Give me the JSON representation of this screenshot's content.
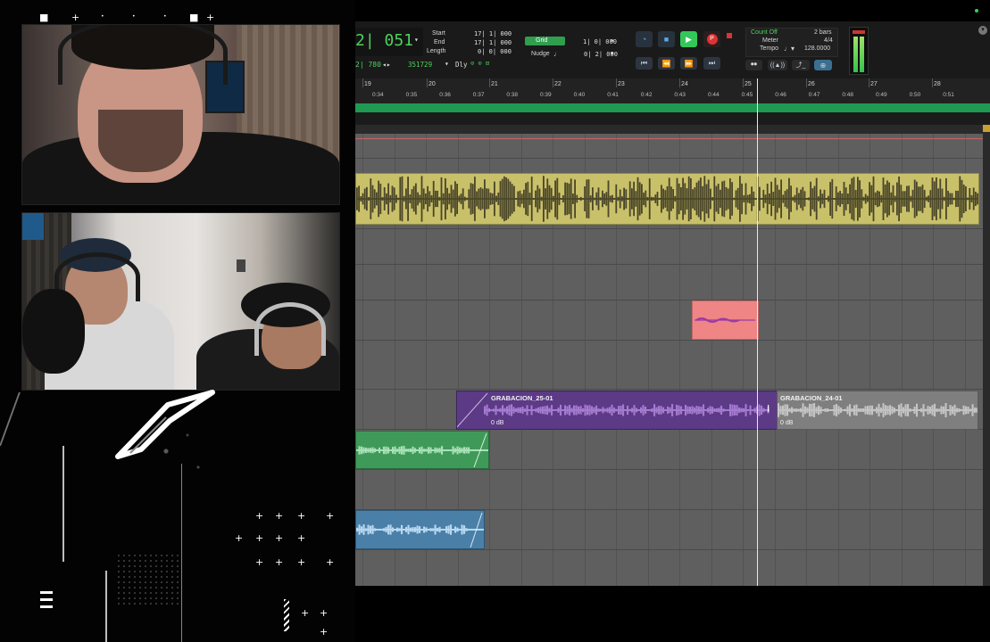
{
  "stream": {
    "logo": "white-v-logo-icon",
    "menu_icon": "menu-icon"
  },
  "transport": {
    "main_counter": "2| 051",
    "sub_counter": "2| 780",
    "samples": "351729",
    "dly": "Dly",
    "start_label": "Start",
    "end_label": "End",
    "length_label": "Length",
    "start_value": "17| 1| 000",
    "end_value": "17| 1| 000",
    "length_value": "0| 0| 000",
    "grid_label": "Grid",
    "grid_value": "1| 0| 000",
    "nudge_label": "Nudge",
    "nudge_value": "0| 2| 000",
    "count_off": "Count Off",
    "count_off_value": "2 bars",
    "meter_label": "Meter",
    "meter_value": "4/4",
    "tempo_label": "Tempo",
    "tempo_value": "128.0000"
  },
  "ruler": {
    "bars": [
      {
        "label": "19",
        "pos": 10
      },
      {
        "label": "20",
        "pos": 82
      },
      {
        "label": "21",
        "pos": 152
      },
      {
        "label": "22",
        "pos": 223
      },
      {
        "label": "23",
        "pos": 294
      },
      {
        "label": "24",
        "pos": 365
      },
      {
        "label": "25",
        "pos": 436
      },
      {
        "label": "26",
        "pos": 507
      },
      {
        "label": "27",
        "pos": 577
      },
      {
        "label": "28",
        "pos": 648
      }
    ],
    "times": [
      "0:34",
      "0:35",
      "0:36",
      "0:37",
      "0:38",
      "0:39",
      "0:40",
      "0:41",
      "0:42",
      "0:43",
      "0:44",
      "0:45",
      "0:46",
      "0:47",
      "0:48",
      "0:49",
      "0:50",
      "0:51"
    ]
  },
  "clips": {
    "grabacion_25": {
      "name": "GRABACION_25-01",
      "gain": "0 dB"
    },
    "grabacion_24": {
      "name": "GRABACION_24-01",
      "gain": "0 dB"
    }
  },
  "colors": {
    "yellow_clip": "#c9c06a",
    "pink_clip": "#ef8585",
    "purple_clip": "#5c3a86",
    "grey_clip": "#8a8a8a",
    "green_clip": "#3f9a59",
    "blue_clip": "#4a7fa8",
    "timeline_green": "#1f9a52"
  }
}
